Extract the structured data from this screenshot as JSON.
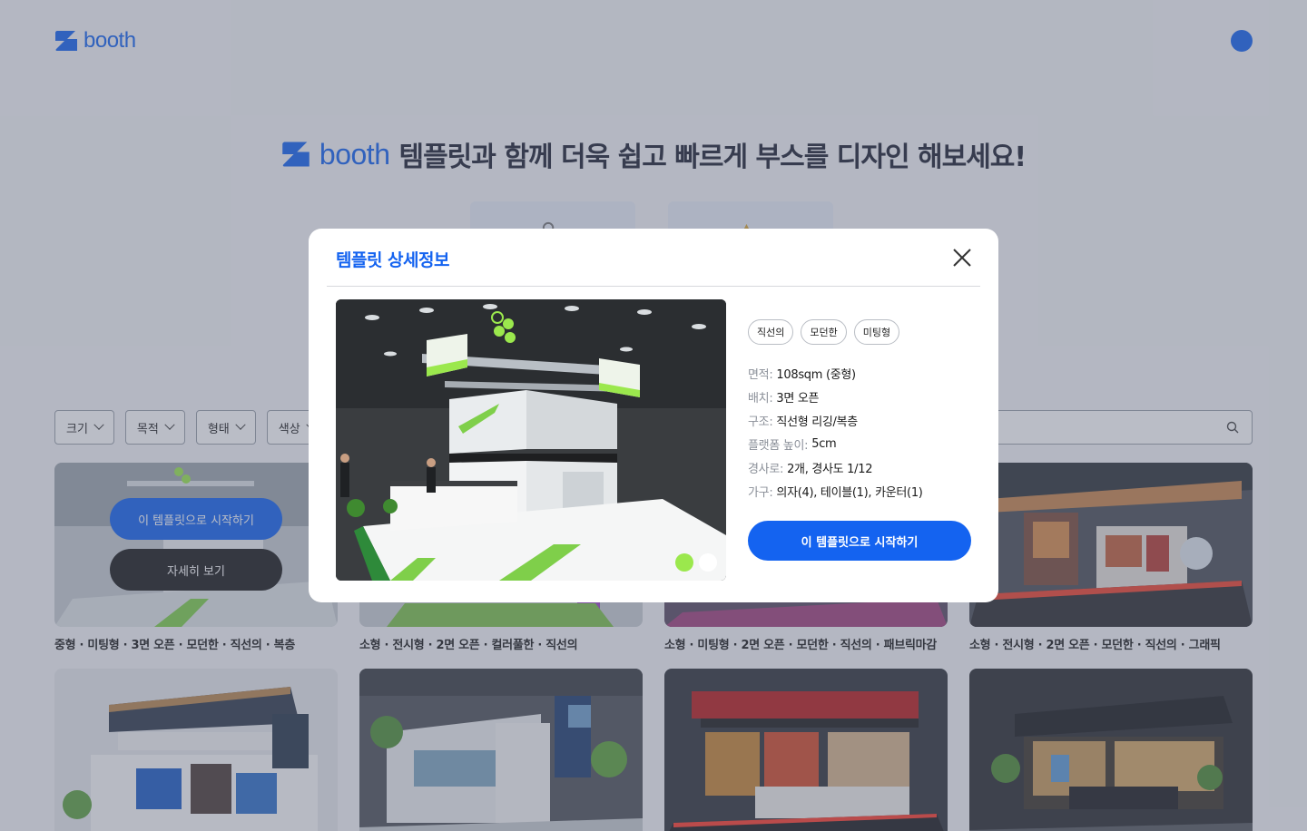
{
  "brand": {
    "name": "booth",
    "color": "#1463f0"
  },
  "hero": {
    "tagline": "템플릿과 함께 더욱 쉽고 빠르게 부스를 디자인 해보세요!"
  },
  "filters": [
    {
      "label": "크기"
    },
    {
      "label": "목적"
    },
    {
      "label": "형태"
    },
    {
      "label": "색상"
    }
  ],
  "search": {
    "icon": "search-icon"
  },
  "grid": {
    "hover": {
      "start_label": "이 템플릿으로 시작하기",
      "detail_label": "자세히 보기"
    },
    "row1": [
      {
        "caption": "중형 · 미팅형 · 3면 오픈 · 모던한 · 직선의 · 복층"
      },
      {
        "caption": "소형 · 전시형 · 2면 오픈 · 컬러풀한 · 직선의"
      },
      {
        "caption": "소형 · 미팅형 · 2면 오픈 · 모던한 · 직선의 · 패브릭마감"
      },
      {
        "caption": "소형 · 전시형 · 2면 오픈 · 모던한 · 직선의 · 그래픽"
      }
    ]
  },
  "modal": {
    "title": "템플릿 상세정보",
    "tags": [
      "직선의",
      "모던한",
      "미팅형"
    ],
    "specs": [
      {
        "key": "면적:",
        "value": "108sqm (중형)"
      },
      {
        "key": "배치:",
        "value": "3면 오픈"
      },
      {
        "key": "구조:",
        "value": "직선형 리깅/복층"
      },
      {
        "key": "플랫폼 높이:",
        "value": "5cm"
      },
      {
        "key": "경사로:",
        "value": "2개, 경사도 1/12"
      },
      {
        "key": "가구:",
        "value": "의자(4), 테이블(1), 카운터(1)"
      }
    ],
    "cta_label": "이 템플릿으로 시작하기",
    "gallery": {
      "image_count": 2,
      "active_index": 0,
      "active_color": "#9be84d"
    }
  }
}
